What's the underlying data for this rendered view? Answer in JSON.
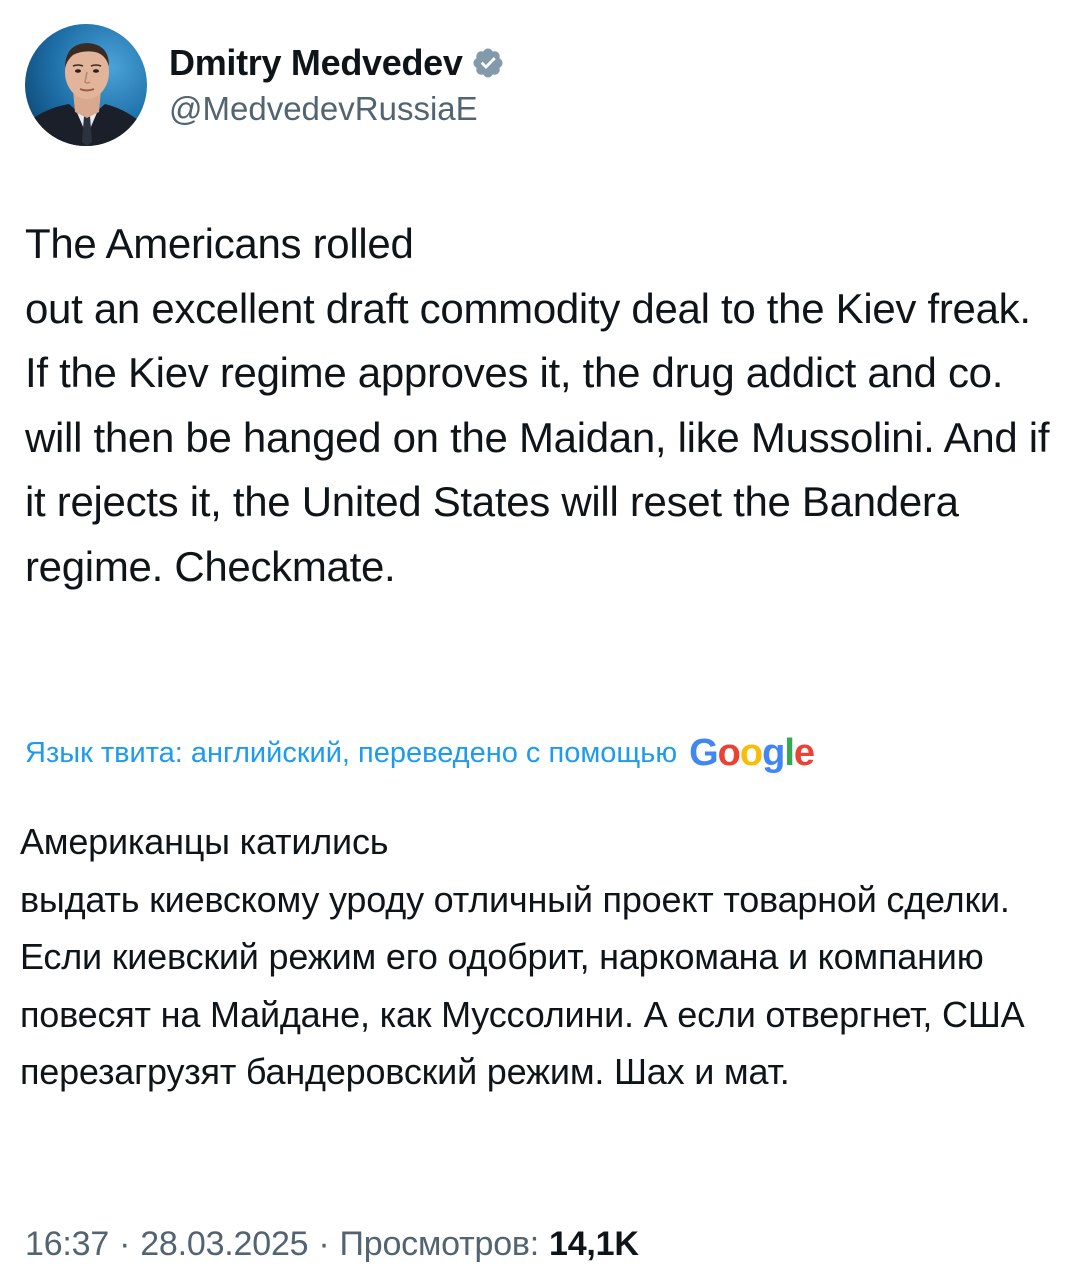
{
  "author": {
    "display_name": "Dmitry Medvedev",
    "handle": "@MedvedevRussiaE",
    "verified": true,
    "verified_badge_color": "#829aab"
  },
  "tweet": {
    "text": "The Americans rolled\nout an excellent draft commodity deal to the Kiev freak. If the Kiev regime approves it, the drug addict and co. will then be hanged on the Maidan, like Mussolini. And if it rejects it, the United States will reset the Bandera regime. Checkmate."
  },
  "translation": {
    "label": "Язык твита: английский, переведено с помощью",
    "provider_logo": "Google",
    "label_color": "#1d9bf0",
    "text": "Американцы катились\nвыдать киевскому уроду отличный проект товарной сделки. Если киевский режим его одобрит, наркомана и компанию повесят на Майдане, как Муссолини. А если отвергнет, США перезагрузят бандеровский режим. Шах и мат."
  },
  "meta": {
    "time": "16:37",
    "separator": "·",
    "date": "28.03.2025",
    "views_label": "Просмотров:",
    "views_count": "14,1K"
  },
  "icons": {
    "verified": "verified-badge-icon",
    "avatar": "profile-avatar"
  }
}
